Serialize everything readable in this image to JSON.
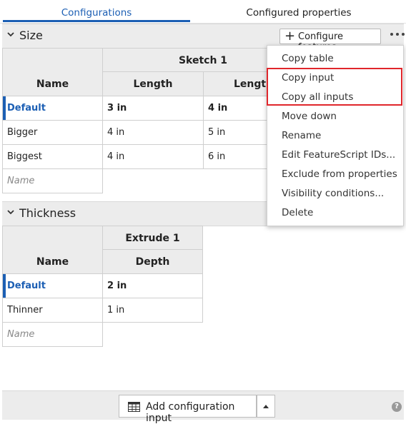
{
  "tabs": [
    {
      "label": "Configurations",
      "active": true
    },
    {
      "label": "Configured properties",
      "active": false
    }
  ],
  "size": {
    "title": "Size",
    "configure_label": "Configure features",
    "feature": "Sketch 1",
    "name_header": "Name",
    "columns": [
      "Length",
      "Length"
    ],
    "rows": [
      {
        "name": "Default",
        "values": [
          "3 in",
          "4 in"
        ],
        "default": true
      },
      {
        "name": "Bigger",
        "values": [
          "4 in",
          "5 in"
        ],
        "default": false
      },
      {
        "name": "Biggest",
        "values": [
          "4 in",
          "6 in"
        ],
        "default": false
      }
    ],
    "name_placeholder": "Name"
  },
  "thickness": {
    "title": "Thickness",
    "feature": "Extrude 1",
    "name_header": "Name",
    "column": "Depth",
    "rows": [
      {
        "name": "Default",
        "value": "2 in",
        "default": true
      },
      {
        "name": "Thinner",
        "value": "1 in",
        "default": false
      }
    ],
    "name_placeholder": "Name"
  },
  "menu": {
    "items": [
      "Copy table",
      "Copy input",
      "Copy all inputs",
      "Move down",
      "Rename",
      "Edit FeatureScript IDs...",
      "Exclude from properties",
      "Visibility conditions...",
      "Delete"
    ],
    "highlighted": [
      "Copy input",
      "Copy all inputs"
    ],
    "highlight_color": "#e0262b"
  },
  "footer": {
    "add_label": "Add configuration input",
    "help_icon": "question-icon"
  },
  "colors": {
    "accent": "#1c5fb4",
    "header_bg": "#ececec"
  }
}
